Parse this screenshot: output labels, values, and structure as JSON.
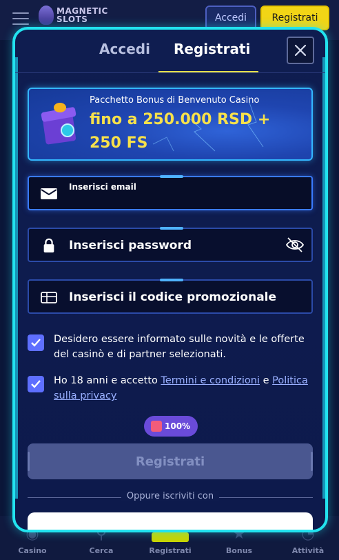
{
  "header": {
    "logo_line1": "MAGNETIC",
    "logo_line2": "SLOTS",
    "accedi_label": "Accedi",
    "registrati_label": "Registrati"
  },
  "bottom_nav": [
    {
      "label": "Casino",
      "icon": "casino-icon"
    },
    {
      "label": "Cerca",
      "icon": "search-icon"
    },
    {
      "label": "Registrati",
      "icon": "register-icon"
    },
    {
      "label": "Bonus",
      "icon": "bonus-icon"
    },
    {
      "label": "Attività",
      "icon": "activity-icon"
    }
  ],
  "modal": {
    "tabs": [
      {
        "label": "Accedi",
        "active": false
      },
      {
        "label": "Registrati",
        "active": true
      }
    ],
    "close_icon": "close-icon",
    "bonus": {
      "subtitle": "Pacchetto Bonus di Benvenuto Casino",
      "headline": "fino a 250.000 RSD + 250 FS"
    },
    "fields": {
      "email_label": "Inserisci email",
      "password_label": "Inserisci password",
      "promo_label": "Inserisci il codice promozionale"
    },
    "checks": {
      "newsletter_text": "Desidero essere informato sulle novità e le offerte del casinò e di partner selezionati.",
      "terms_prefix": "Ho 18 anni e accetto ",
      "terms_link": "Termini e condizioni",
      "terms_mid": " e ",
      "privacy_link": "Politica sulla privacy"
    },
    "progress_label": "100%",
    "progress_value": 100,
    "submit_label": "Registrati",
    "oppure_label": "Oppure iscriviti con"
  },
  "colors": {
    "accent_border": "#22e3ef",
    "bonus_text": "#f7e14b",
    "checkbox": "#5e6fff",
    "tab_underline": "#e7e14a"
  }
}
